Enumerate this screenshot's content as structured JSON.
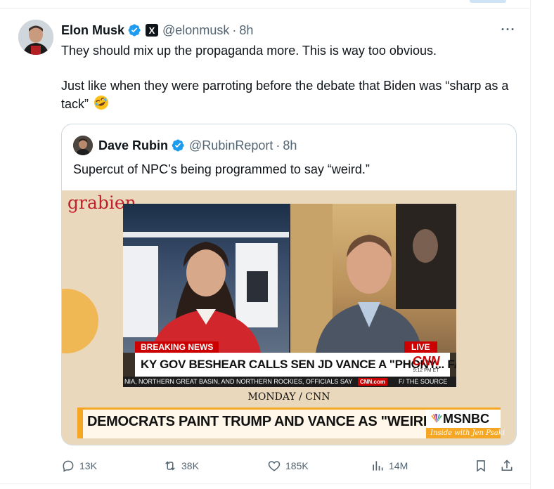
{
  "tweet": {
    "author": {
      "name": "Elon Musk",
      "handle": "@elonmusk",
      "time": "8h",
      "verified": true,
      "affiliate_badge": "X"
    },
    "text": {
      "paragraph1": "They should mix up the propaganda more. This is way too obvious.",
      "paragraph2": "Just like when they were parroting before the debate that Biden was “sharp as a tack”",
      "emoji": "rolling-on-the-floor-laughing"
    },
    "more_icon": "more-horizontal-icon",
    "quoted": {
      "author": {
        "name": "Dave Rubin",
        "handle": "@RubinReport",
        "time": "8h",
        "verified": true
      },
      "text": "Supercut of NPC’s being programmed to say “weird.”",
      "video": {
        "watermark": "grabien",
        "breaking_label": "BREAKING NEWS",
        "live_label": "LIVE",
        "headline": "KY GOV BESHEAR CALLS SEN JD VANCE A \"PHONY... FAKE\"",
        "network_logo": "CNN",
        "network_time": "9:12 PM ET",
        "ticker": "NIA, NORTHERN GREAT BASIN, AND NORTHERN ROCKIES, OFFICIALS SAY",
        "ticker_badge": "CNN.com",
        "ticker_source": "F/ THE SOURCE",
        "caption": "MONDAY / CNN",
        "banner": "DEMOCRATS PAINT TRUMP AND VANCE AS \"WEIRD\"",
        "banner_logo": "MSNBC",
        "banner_show": "Inside with Jen Psaki"
      }
    },
    "actions": {
      "replies": "13K",
      "reposts": "38K",
      "likes": "185K",
      "views": "14M"
    }
  },
  "colors": {
    "text_primary": "#0f1419",
    "text_secondary": "#536471",
    "verified_blue": "#1d9bf0",
    "border": "#cfd9de",
    "cnn_red": "#cc0000",
    "msnbc_orange": "#f5a623"
  }
}
